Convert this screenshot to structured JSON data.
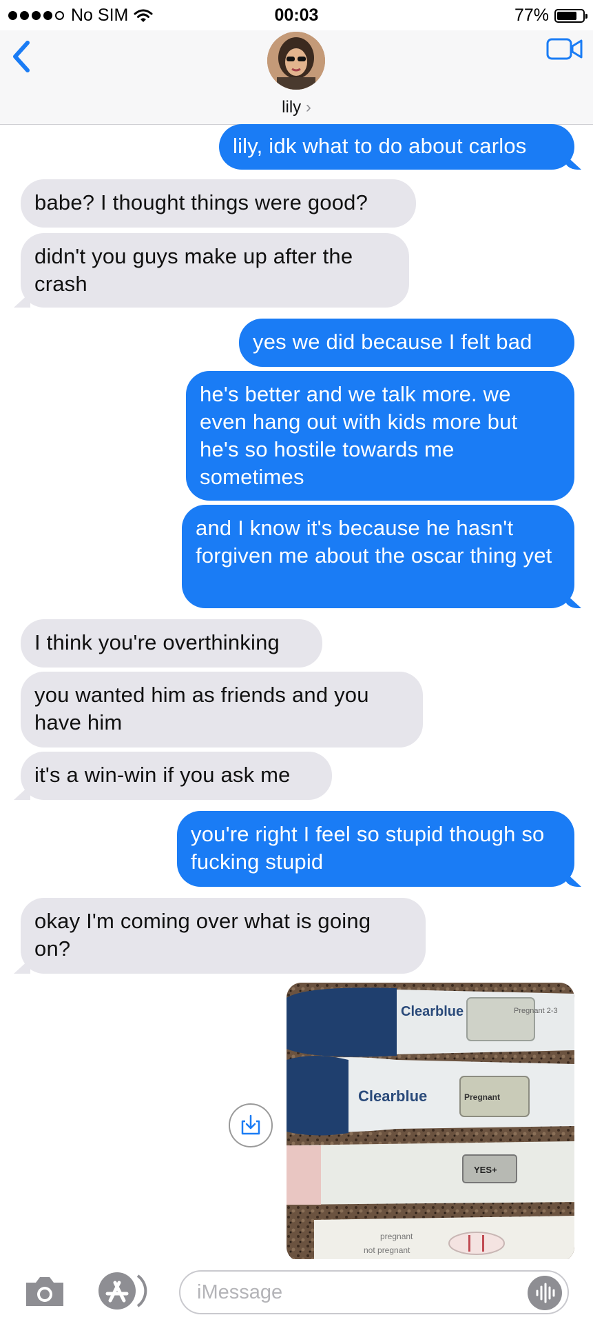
{
  "status_bar": {
    "carrier": "No SIM",
    "time": "00:03",
    "battery_percent": "77%",
    "battery_level": 0.77,
    "signal_bars_filled": 4,
    "signal_bars_total": 5
  },
  "header": {
    "back_icon": "chevron-left-icon",
    "contact_name": "lily",
    "contact_chevron": "›",
    "video_call_icon": "video-camera-icon"
  },
  "messages": [
    {
      "side": "out",
      "text": "lily, idk what to do about carlos"
    },
    {
      "side": "in",
      "text": "babe? I thought things were good?"
    },
    {
      "side": "in",
      "text": "didn't you guys make up after the crash"
    },
    {
      "side": "out",
      "text": "yes we did because I felt bad"
    },
    {
      "side": "out",
      "text": "he's better and we talk more. we even hang out with kids more but he's so hostile towards me sometimes"
    },
    {
      "side": "out",
      "text": "and I know it's because he hasn't forgiven me about the oscar thing yet"
    },
    {
      "side": "in",
      "text": "I think you're overthinking"
    },
    {
      "side": "in",
      "text": "you wanted him as friends and you have him"
    },
    {
      "side": "in",
      "text": "it's a win-win if you ask me"
    },
    {
      "side": "out",
      "text": "you're right I feel so stupid though so fucking stupid"
    },
    {
      "side": "in",
      "text": "okay I'm coming over what is going on?"
    }
  ],
  "photo": {
    "brand_1": "Clearblue",
    "window_1": "Pregnant 2-3",
    "brand_2": "Clearblue",
    "window_2": "Pregnant",
    "window_3": "YES+",
    "test_4_line1": "pregnant",
    "test_4_line2": "not pregnant"
  },
  "photo_save_icon": "download-icon",
  "input_bar": {
    "camera_icon": "camera-icon",
    "apps_icon": "app-store-icon",
    "placeholder": "iMessage",
    "audio_icon": "waveform-icon"
  },
  "colors": {
    "outgoing_bubble": "#1a7cf5",
    "incoming_bubble": "#e6e5eb",
    "accent": "#1a7cf5"
  }
}
